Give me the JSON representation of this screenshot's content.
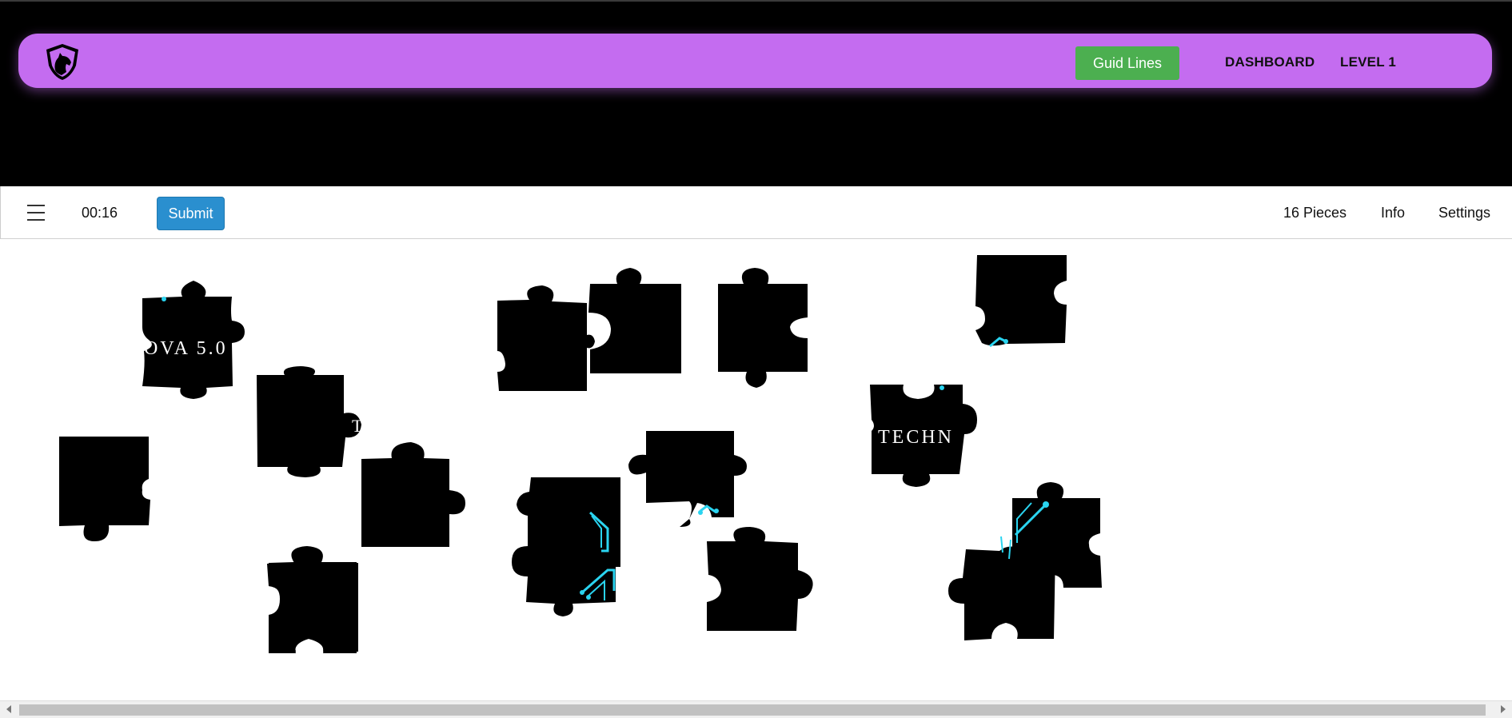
{
  "header": {
    "logo_icon": "horse-shield-logo",
    "guide_button_label": "Guid Lines",
    "nav_links": [
      "DASHBOARD",
      "LEVEL 1"
    ],
    "nav_color": "#c46cf0",
    "guide_button_color": "#4caf50"
  },
  "toolbar": {
    "menu_icon": "hamburger-menu-icon",
    "timer": "00:16",
    "submit_label": "Submit",
    "submit_color": "#2a8fcf",
    "pieces_label": "16 Pieces",
    "info_label": "Info",
    "settings_label": "Settings"
  },
  "puzzle": {
    "piece_count": 16,
    "piece_texts": [
      "OVA 5.0",
      "T",
      "TECHN"
    ],
    "circuit_color": "#2ad4f0"
  }
}
